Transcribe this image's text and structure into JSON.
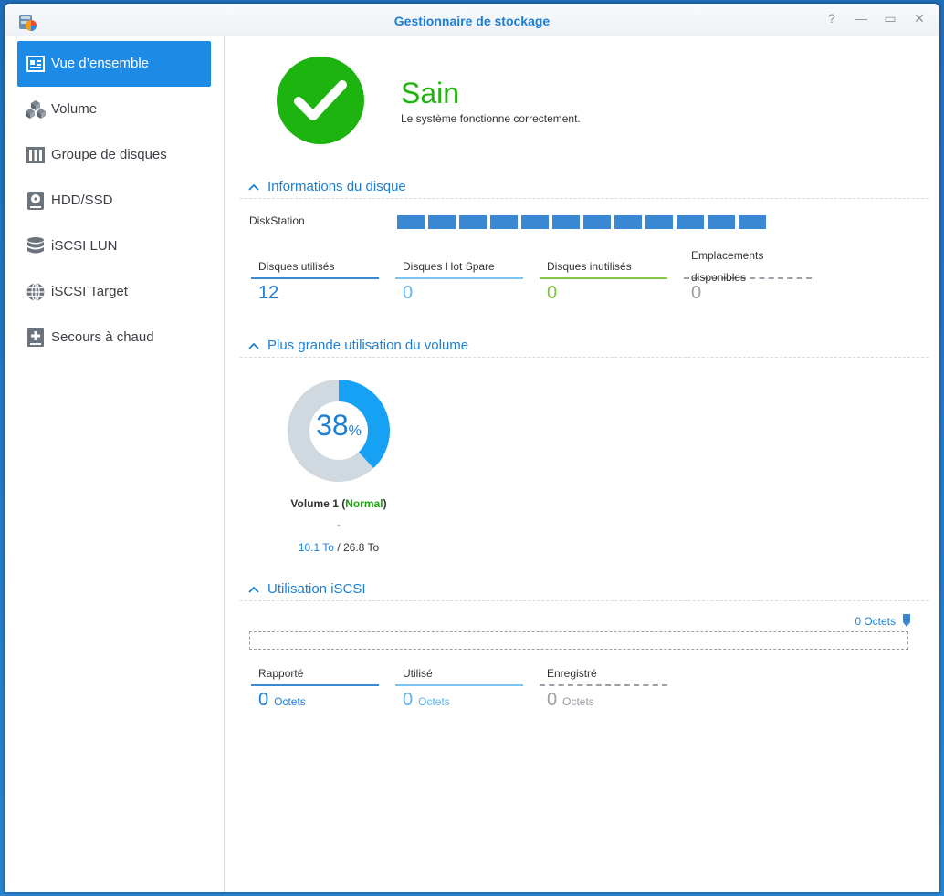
{
  "window": {
    "title": "Gestionnaire de stockage",
    "controls": [
      "?",
      "—",
      "▭",
      "✕"
    ]
  },
  "sidebar": {
    "items": [
      {
        "label": "Vue d’ensemble",
        "icon": "overview-card-icon",
        "active": true
      },
      {
        "label": "Volume",
        "icon": "cubes-icon",
        "active": false
      },
      {
        "label": "Groupe de disques",
        "icon": "disk-group-icon",
        "active": false
      },
      {
        "label": "HDD/SSD",
        "icon": "hard-disk-icon",
        "active": false
      },
      {
        "label": "iSCSI LUN",
        "icon": "database-stack-icon",
        "active": false
      },
      {
        "label": "iSCSI Target",
        "icon": "globe-icon",
        "active": false
      },
      {
        "label": "Secours à chaud",
        "icon": "hot-spare-plus-icon",
        "active": false
      }
    ]
  },
  "status": {
    "title": "Sain",
    "subtitle": "Le système fonctionne correctement.",
    "color": "#21b30f"
  },
  "disk_info": {
    "section_title": "Informations du disque",
    "device_label": "DiskStation",
    "disk_count": 12,
    "stats": [
      {
        "label": "Disques utilisés",
        "value": "12",
        "color": "#1b7fd4",
        "bar": "#3a88d4"
      },
      {
        "label": "Disques Hot Spare",
        "value": "0",
        "color": "#5cb4ef",
        "bar": "#7cc3f2"
      },
      {
        "label": "Disques inutilisés",
        "value": "0",
        "color": "#7ec13a",
        "bar": "#8ac84a"
      },
      {
        "label": "Emplacements disponibles",
        "value": "0",
        "color": "#9aa0a6",
        "bar": "dashed"
      }
    ]
  },
  "volume_usage": {
    "section_title": "Plus grande utilisation du volume",
    "percent": "38",
    "percent_sign": "%",
    "percent_value": 0.38,
    "volume_name": "Volume 1",
    "volume_status": "Normal",
    "dash": "-",
    "used": "10.1 To",
    "separator": " / ",
    "total": "26.8 To",
    "colors": {
      "used": "#16a1f4",
      "free": "#d0d8e0"
    }
  },
  "iscsi": {
    "section_title": "Utilisation iSCSI",
    "meter_label": "0 Octets",
    "stats": [
      {
        "label": "Rapporté",
        "value": "0",
        "unit": "Octets",
        "color": "#1b7fd4",
        "bar": "#3a88d4"
      },
      {
        "label": "Utilisé",
        "value": "0",
        "unit": "Octets",
        "color": "#5cb4ef",
        "bar": "#7cc3f2"
      },
      {
        "label": "Enregistré",
        "value": "0",
        "unit": "Octets",
        "color": "#9aa0a6",
        "bar": "dashed"
      }
    ]
  }
}
